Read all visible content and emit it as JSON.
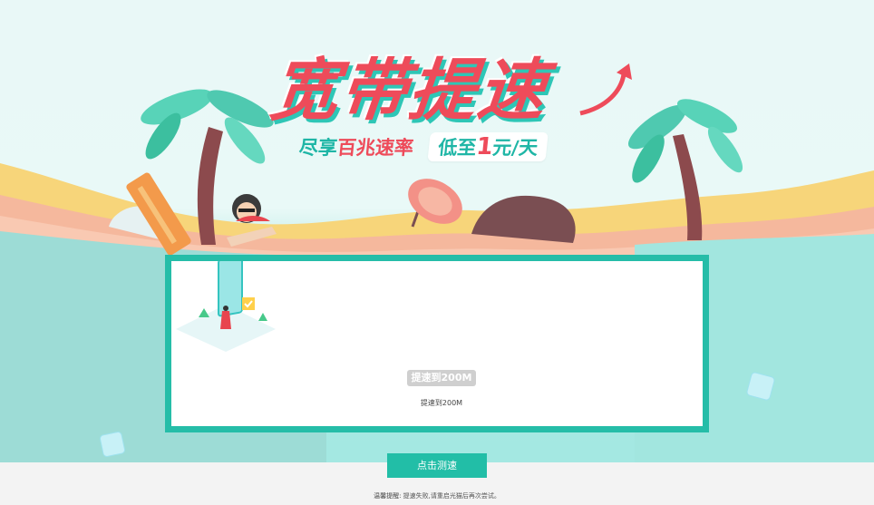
{
  "banner": {
    "headline": "宽带提速",
    "subline_part1": "尽享",
    "subline_highlight": "百兆速率",
    "price_prefix": "低至",
    "price_value": "1",
    "price_suffix": "元/天"
  },
  "card": {
    "speed_badge": "提速到200M",
    "speed_caption": "提速到200M"
  },
  "action": {
    "button_label": "点击测速"
  },
  "notice": {
    "label": "温馨提醒:",
    "text": "提速失败,请重启光猫后再次尝试。"
  },
  "colors": {
    "accent": "#22bea7",
    "headline_red": "#ee4b5a",
    "card_border": "#25bda8"
  },
  "icons": [
    "palm-tree-icon",
    "beach-umbrella-icon",
    "sunbather-icon",
    "ice-cube-icon",
    "phone-speed-illustration"
  ]
}
